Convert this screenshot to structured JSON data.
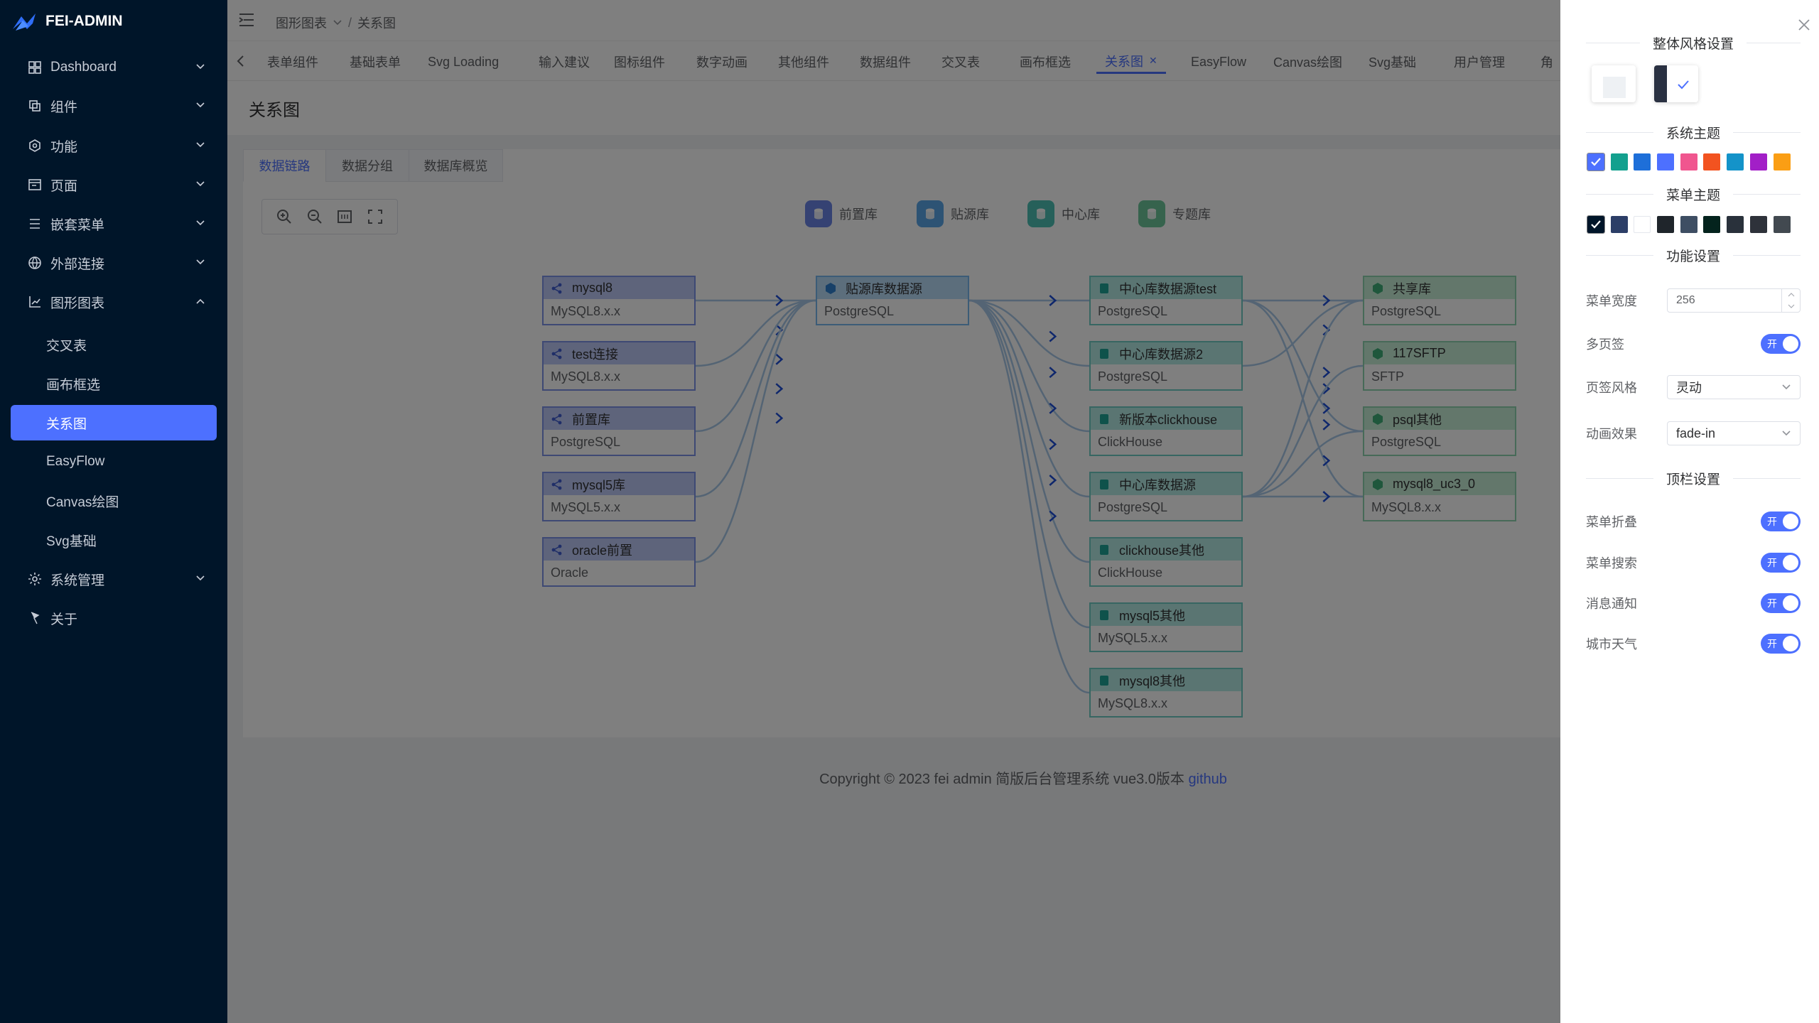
{
  "app": {
    "name": "FEI-ADMIN"
  },
  "sidebar": {
    "items": [
      {
        "label": "Dashboard",
        "icon": "dashboard-icon"
      },
      {
        "label": "组件",
        "icon": "component-icon"
      },
      {
        "label": "功能",
        "icon": "function-icon"
      },
      {
        "label": "页面",
        "icon": "page-icon"
      },
      {
        "label": "嵌套菜单",
        "icon": "menu-icon"
      },
      {
        "label": "外部连接",
        "icon": "globe-icon"
      },
      {
        "label": "图形图表",
        "icon": "chart-icon"
      },
      {
        "label": "交叉表",
        "sub": true
      },
      {
        "label": "画布框选",
        "sub": true
      },
      {
        "label": "关系图",
        "sub": true,
        "active": true
      },
      {
        "label": "EasyFlow",
        "sub": true
      },
      {
        "label": "Canvas绘图",
        "sub": true
      },
      {
        "label": "Svg基础",
        "sub": true
      },
      {
        "label": "系统管理",
        "icon": "gear-icon"
      },
      {
        "label": "关于",
        "icon": "flag-icon"
      }
    ]
  },
  "header": {
    "breadcrumb": [
      "图形图表",
      "关系图"
    ]
  },
  "tabs": [
    "表单组件",
    "基础表单",
    "Svg Loading",
    "输入建议",
    "图标组件",
    "数字动画",
    "其他组件",
    "数据组件",
    "交叉表",
    "画布框选",
    "关系图",
    "EasyFlow",
    "Canvas绘图",
    "Svg基础",
    "用户管理",
    "角"
  ],
  "active_tab": "关系图",
  "page_title": "关系图",
  "inner_tabs": [
    "数据链路",
    "数据分组",
    "数据库概览"
  ],
  "graph": {
    "legend": [
      {
        "label": "前置库",
        "color": "#6b84e6"
      },
      {
        "label": "贴源库",
        "color": "#5aa6e8"
      },
      {
        "label": "中心库",
        "color": "#4cc1b5"
      },
      {
        "label": "专题库",
        "color": "#6cc79a"
      }
    ],
    "nodes": [
      {
        "name": "mysql8",
        "db": "MySQL8.x.x",
        "type": "qz"
      },
      {
        "name": "test连接",
        "db": "MySQL8.x.x",
        "type": "qz"
      },
      {
        "name": "前置库",
        "db": "PostgreSQL",
        "type": "qz"
      },
      {
        "name": "mysql5库",
        "db": "MySQL5.x.x",
        "type": "qz"
      },
      {
        "name": "oracle前置",
        "db": "Oracle",
        "type": "qz"
      },
      {
        "name": "贴源库数据源",
        "db": "PostgreSQL",
        "type": "ty"
      },
      {
        "name": "中心库数据源test",
        "db": "PostgreSQL",
        "type": "zx"
      },
      {
        "name": "中心库数据源2",
        "db": "PostgreSQL",
        "type": "zx"
      },
      {
        "name": "新版本clickhouse",
        "db": "ClickHouse",
        "type": "zx"
      },
      {
        "name": "中心库数据源",
        "db": "PostgreSQL",
        "type": "zx"
      },
      {
        "name": "clickhouse其他",
        "db": "ClickHouse",
        "type": "zx"
      },
      {
        "name": "mysql5其他",
        "db": "MySQL5.x.x",
        "type": "zx"
      },
      {
        "name": "mysql8其他",
        "db": "MySQL8.x.x",
        "type": "zx"
      },
      {
        "name": "共享库",
        "db": "PostgreSQL",
        "type": "zt"
      },
      {
        "name": "117SFTP",
        "db": "SFTP",
        "type": "zt"
      },
      {
        "name": "psql其他",
        "db": "PostgreSQL",
        "type": "zt"
      },
      {
        "name": "mysql8_uc3_0",
        "db": "MySQL8.x.x",
        "type": "zt"
      }
    ]
  },
  "footer": {
    "text": "Copyright © 2023 fei admin 简版后台管理系统 vue3.0版本",
    "link": "github"
  },
  "drawer": {
    "overall_style_title": "整体风格设置",
    "system_theme_title": "系统主题",
    "system_theme_colors": [
      "#4d70ff",
      "#13a08e",
      "#1e6fd9",
      "#4d70ff",
      "#f0568f",
      "#f25320",
      "#1493c9",
      "#a21fc7",
      "#fa9e14"
    ],
    "menu_theme_title": "菜单主题",
    "menu_theme_colors": [
      "#001529",
      "#2c3e67",
      "#ffffff",
      "#1f252b",
      "#3e4e63",
      "#04231d",
      "#29313b",
      "#2e323a",
      "#424950"
    ],
    "function_title": "功能设置",
    "menu_width_label": "菜单宽度",
    "menu_width_value": "256",
    "multi_tab_label": "多页签",
    "tab_style_label": "页签风格",
    "tab_style_value": "灵动",
    "animation_label": "动画效果",
    "animation_value": "fade-in",
    "topbar_title": "顶栏设置",
    "menu_collapse_label": "菜单折叠",
    "menu_search_label": "菜单搜索",
    "notify_label": "消息通知",
    "weather_label": "城市天气",
    "switch_on": "开"
  }
}
